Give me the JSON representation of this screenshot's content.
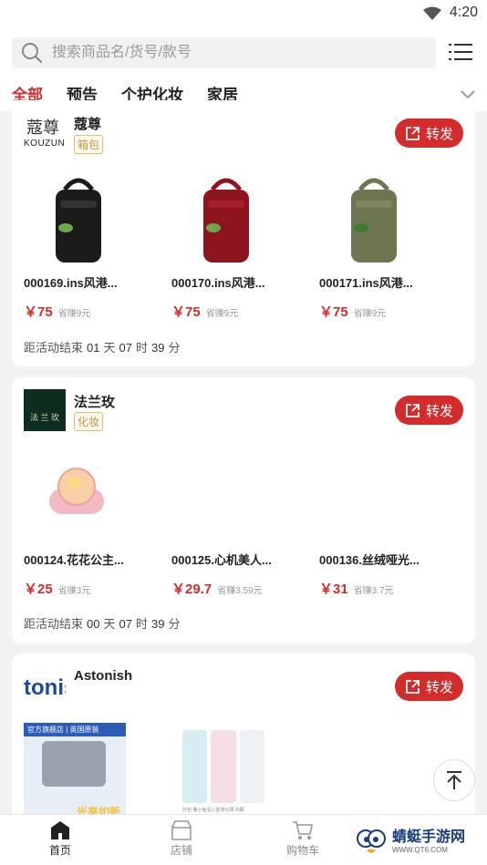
{
  "status_bar": {
    "time": "4:20"
  },
  "search": {
    "placeholder": "搜索商品名/货号/款号"
  },
  "tabs": [
    {
      "label": "全部",
      "active": true
    },
    {
      "label": "预告"
    },
    {
      "label": "个护化妆"
    },
    {
      "label": "家居"
    }
  ],
  "cards": [
    {
      "brand": "蔻尊",
      "logo_text": "KOUZUN",
      "tag": "箱包",
      "share_label": "转发",
      "products": [
        {
          "title": "000169.ins风港...",
          "price": "￥75",
          "save": "省赚9元",
          "color": "#1b1b1b"
        },
        {
          "title": "000170.ins风港...",
          "price": "￥75",
          "save": "省赚9元",
          "color": "#8e1520"
        },
        {
          "title": "000171.ins风港...",
          "price": "￥75",
          "save": "省赚9元",
          "color": "#6d7551"
        }
      ],
      "countdown": {
        "prefix": "距活动结束",
        "days": "01",
        "d": "天",
        "hours": "07",
        "h": "时",
        "mins": "39",
        "m": "分"
      }
    },
    {
      "brand": "法兰玫",
      "logo_text": "法 兰 玫",
      "tag": "化妆",
      "share_label": "转发",
      "products": [
        {
          "title": "000124.花花公主...",
          "price": "￥25",
          "save": "省赚3元"
        },
        {
          "title": "000125.心机美人...",
          "price": "￥29.7",
          "save": "省赚3.59元"
        },
        {
          "title": "000136.丝绒哑光...",
          "price": "￥31",
          "save": "省赚3.7元"
        }
      ],
      "countdown": {
        "prefix": "距活动结束",
        "days": "00",
        "d": "天",
        "hours": "07",
        "h": "时",
        "mins": "39",
        "m": "分"
      }
    },
    {
      "brand": "Astonish",
      "logo_text": "tonis",
      "share_label": "转发",
      "promo_texts": {
        "banner": "官方旗舰店 | 英国原装",
        "slogan": "光亮如新",
        "pack": "外包  撒小兔宝心苗落长颈  内联"
      }
    }
  ],
  "bottom_nav": [
    {
      "label": "首页",
      "active": true
    },
    {
      "label": "店铺"
    },
    {
      "label": "购物车"
    }
  ],
  "watermark": {
    "title": "蜻蜓手游网",
    "sub": "WWW.QT6.COM"
  },
  "colors": {
    "accent": "#d42b2b",
    "tag": "#c8943f"
  }
}
